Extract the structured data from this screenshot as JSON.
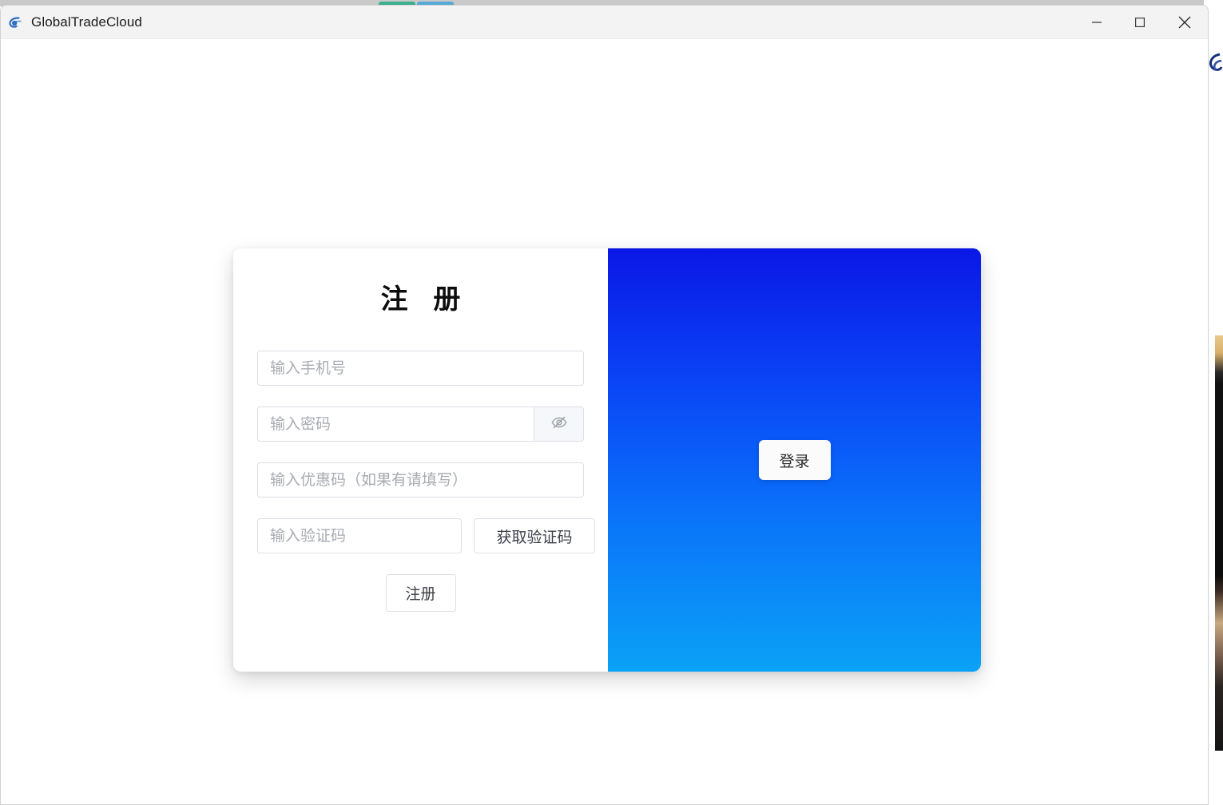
{
  "window": {
    "title": "GlobalTradeCloud",
    "logo_icon": "globe-swoosh-icon",
    "controls": {
      "minimize_icon": "minimize-icon",
      "maximize_icon": "maximize-icon",
      "close_icon": "close-icon"
    }
  },
  "background": {
    "tabs": [
      {
        "name": "tab-sliver-green",
        "color": "#3dae8e"
      },
      {
        "name": "tab-sliver-cyan",
        "color": "#54a9d6"
      }
    ],
    "desktop_logo_icon": "partial-logo-icon"
  },
  "auth_card": {
    "register": {
      "title": "注 册",
      "fields": [
        {
          "name": "phone",
          "placeholder": "输入手机号",
          "value": ""
        },
        {
          "name": "password",
          "placeholder": "输入密码",
          "value": "",
          "toggle_icon": "eye-slash-icon"
        },
        {
          "name": "promo_code",
          "placeholder": "输入优惠码（如果有请填写）",
          "value": ""
        },
        {
          "name": "captcha",
          "placeholder": "输入验证码",
          "value": ""
        }
      ],
      "captcha_button_label": "获取验证码",
      "submit_label": "注册"
    },
    "login": {
      "button_label": "登录",
      "gradient_top": "#0a17e6",
      "gradient_bottom": "#0aa2f6"
    }
  }
}
